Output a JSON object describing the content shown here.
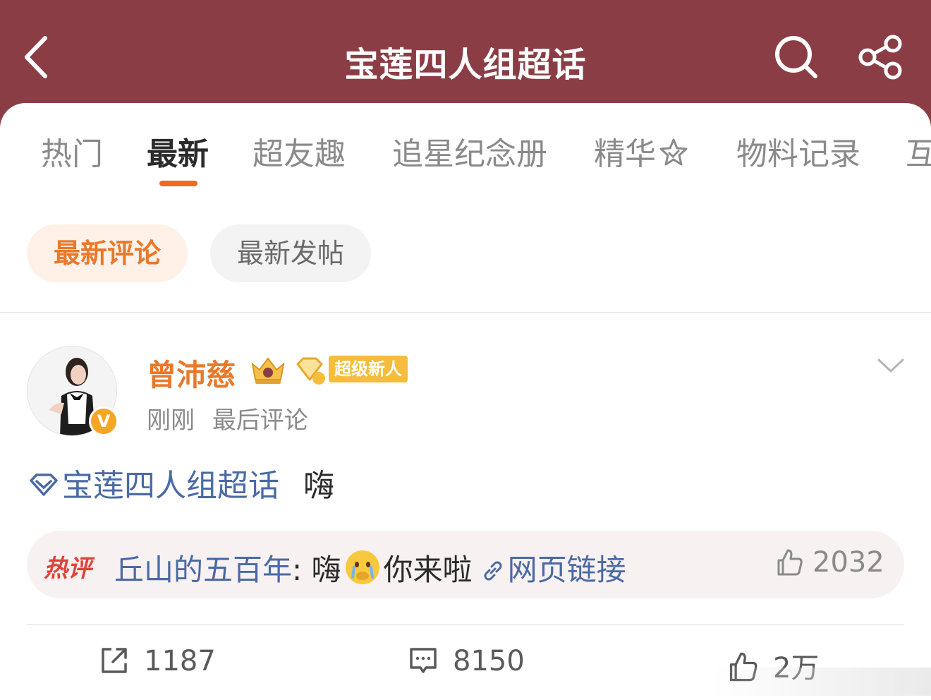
{
  "header": {
    "title": "宝莲四人组超话",
    "background": "#8b3d45"
  },
  "tabs": [
    {
      "label": "热门",
      "active": false
    },
    {
      "label": "最新",
      "active": true
    },
    {
      "label": "超友趣",
      "active": false
    },
    {
      "label": "追星纪念册",
      "active": false
    },
    {
      "label": "精华",
      "active": false
    },
    {
      "label": "物料记录",
      "active": false
    },
    {
      "label": "互",
      "active": false
    }
  ],
  "filters": {
    "latest_comments": "最新评论",
    "latest_posts": "最新发帖"
  },
  "post": {
    "author": "曾沛慈",
    "verified_badge": "V",
    "tag_label": "超级新人",
    "time": "刚刚",
    "meta_note": "最后评论",
    "topic": "宝莲四人组超话",
    "text": "嗨",
    "hot_comment": {
      "tag": "热评",
      "author": "丘山的五百年",
      "separator": ":",
      "text_before": "嗨",
      "text_after": "你来啦",
      "link_label": "网页链接",
      "likes": "2032"
    },
    "actions": {
      "reposts": "1187",
      "comments": "8150",
      "likes": "2万"
    }
  },
  "colors": {
    "accent": "#e8792a",
    "link": "#4a6aa5",
    "hot": "#e0433c"
  }
}
